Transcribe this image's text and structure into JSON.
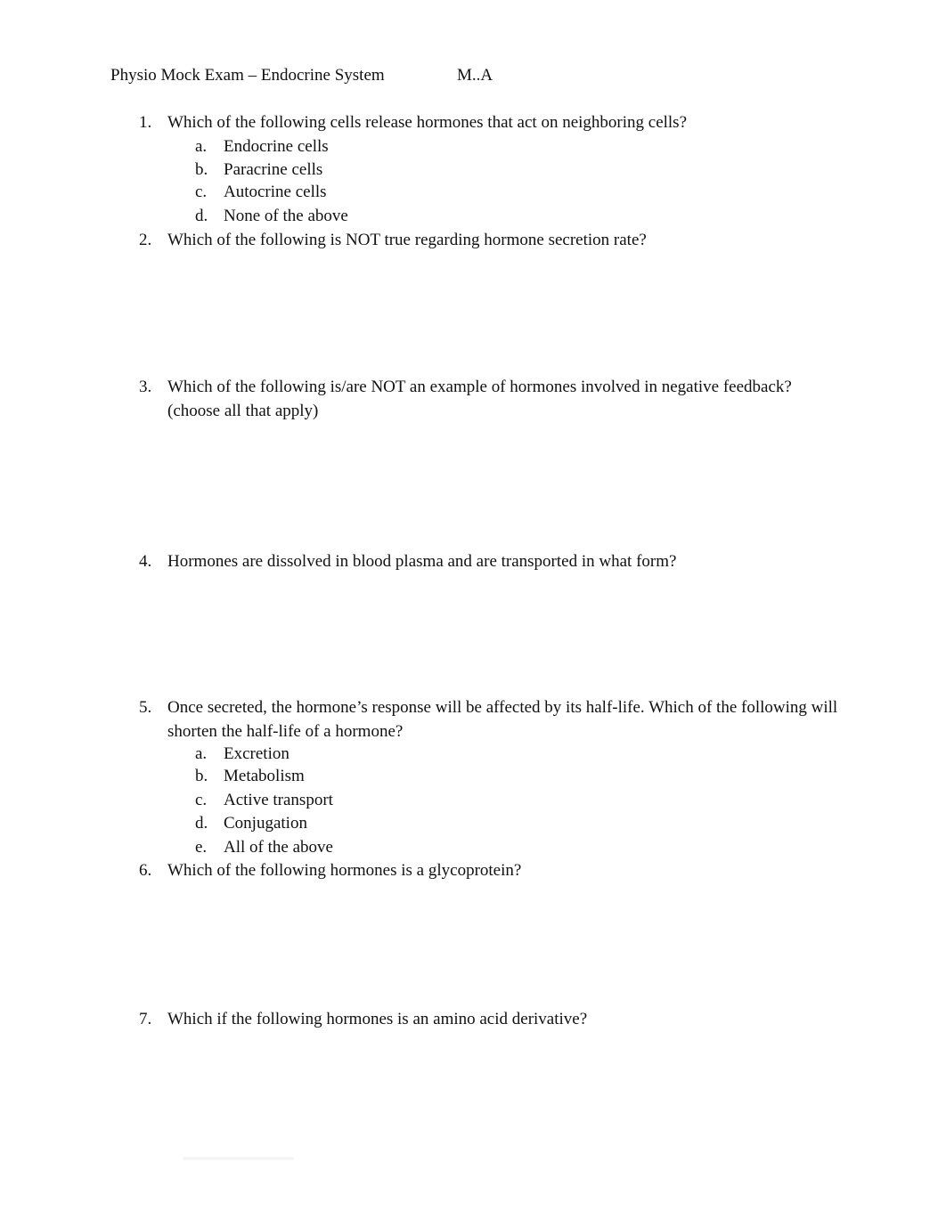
{
  "header": {
    "title": "Physio Mock Exam – Endocrine System",
    "initials": "M..A"
  },
  "questions": [
    {
      "number": "1.",
      "text": "Which of the following cells release hormones that act on neighboring cells?",
      "options": [
        {
          "letter": "a.",
          "text": "Endocrine cells"
        },
        {
          "letter": "b.",
          "text": "Paracrine cells"
        },
        {
          "letter": "c.",
          "text": "Autocrine cells"
        },
        {
          "letter": "d.",
          "text": "None of the above"
        }
      ]
    },
    {
      "number": "2.",
      "text": "Which of the following is NOT true regarding hormone secretion rate?",
      "options": []
    },
    {
      "number": "3.",
      "text": "Which of the following is/are NOT an example of hormones involved in negative feedback? (choose all that apply)",
      "options": []
    },
    {
      "number": "4.",
      "text": "Hormones are dissolved in blood plasma and are transported in what form?",
      "options": []
    },
    {
      "number": "5.",
      "text": "Once secreted, the hormone’s response will be affected by its half-life. Which of the following will shorten the half-life of a hormone?",
      "options": [
        {
          "letter": "a.",
          "text": "Excretion"
        },
        {
          "letter": "b.",
          "text": "Metabolism"
        },
        {
          "letter": "c.",
          "text": "Active transport"
        },
        {
          "letter": "d.",
          "text": "Conjugation"
        },
        {
          "letter": "e.",
          "text": "All of the above"
        }
      ]
    },
    {
      "number": "6.",
      "text": "Which of the following hormones is a glycoprotein?",
      "options": []
    },
    {
      "number": "7.",
      "text": "Which if the following hormones is an amino acid derivative?",
      "options": []
    }
  ]
}
